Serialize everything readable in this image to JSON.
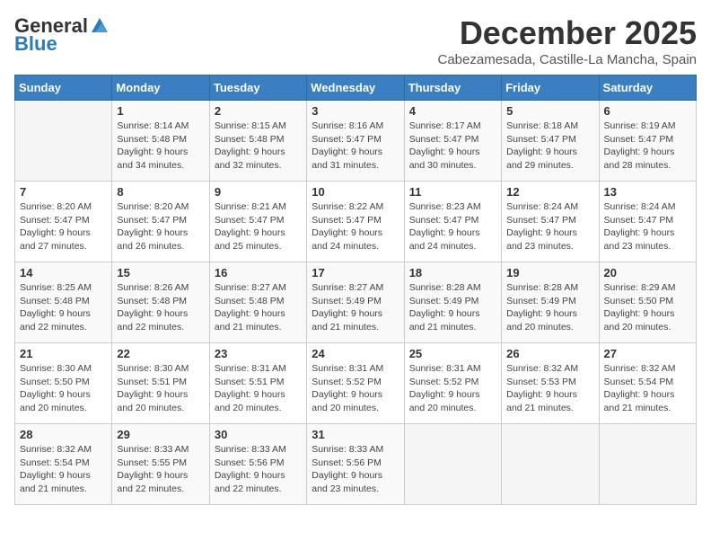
{
  "header": {
    "logo_general": "General",
    "logo_blue": "Blue",
    "month": "December 2025",
    "location": "Cabezamesada, Castille-La Mancha, Spain"
  },
  "days_of_week": [
    "Sunday",
    "Monday",
    "Tuesday",
    "Wednesday",
    "Thursday",
    "Friday",
    "Saturday"
  ],
  "weeks": [
    [
      {
        "day": "",
        "info": ""
      },
      {
        "day": "1",
        "info": "Sunrise: 8:14 AM\nSunset: 5:48 PM\nDaylight: 9 hours\nand 34 minutes."
      },
      {
        "day": "2",
        "info": "Sunrise: 8:15 AM\nSunset: 5:48 PM\nDaylight: 9 hours\nand 32 minutes."
      },
      {
        "day": "3",
        "info": "Sunrise: 8:16 AM\nSunset: 5:47 PM\nDaylight: 9 hours\nand 31 minutes."
      },
      {
        "day": "4",
        "info": "Sunrise: 8:17 AM\nSunset: 5:47 PM\nDaylight: 9 hours\nand 30 minutes."
      },
      {
        "day": "5",
        "info": "Sunrise: 8:18 AM\nSunset: 5:47 PM\nDaylight: 9 hours\nand 29 minutes."
      },
      {
        "day": "6",
        "info": "Sunrise: 8:19 AM\nSunset: 5:47 PM\nDaylight: 9 hours\nand 28 minutes."
      }
    ],
    [
      {
        "day": "7",
        "info": "Sunrise: 8:20 AM\nSunset: 5:47 PM\nDaylight: 9 hours\nand 27 minutes."
      },
      {
        "day": "8",
        "info": "Sunrise: 8:20 AM\nSunset: 5:47 PM\nDaylight: 9 hours\nand 26 minutes."
      },
      {
        "day": "9",
        "info": "Sunrise: 8:21 AM\nSunset: 5:47 PM\nDaylight: 9 hours\nand 25 minutes."
      },
      {
        "day": "10",
        "info": "Sunrise: 8:22 AM\nSunset: 5:47 PM\nDaylight: 9 hours\nand 24 minutes."
      },
      {
        "day": "11",
        "info": "Sunrise: 8:23 AM\nSunset: 5:47 PM\nDaylight: 9 hours\nand 24 minutes."
      },
      {
        "day": "12",
        "info": "Sunrise: 8:24 AM\nSunset: 5:47 PM\nDaylight: 9 hours\nand 23 minutes."
      },
      {
        "day": "13",
        "info": "Sunrise: 8:24 AM\nSunset: 5:47 PM\nDaylight: 9 hours\nand 23 minutes."
      }
    ],
    [
      {
        "day": "14",
        "info": "Sunrise: 8:25 AM\nSunset: 5:48 PM\nDaylight: 9 hours\nand 22 minutes."
      },
      {
        "day": "15",
        "info": "Sunrise: 8:26 AM\nSunset: 5:48 PM\nDaylight: 9 hours\nand 22 minutes."
      },
      {
        "day": "16",
        "info": "Sunrise: 8:27 AM\nSunset: 5:48 PM\nDaylight: 9 hours\nand 21 minutes."
      },
      {
        "day": "17",
        "info": "Sunrise: 8:27 AM\nSunset: 5:49 PM\nDaylight: 9 hours\nand 21 minutes."
      },
      {
        "day": "18",
        "info": "Sunrise: 8:28 AM\nSunset: 5:49 PM\nDaylight: 9 hours\nand 21 minutes."
      },
      {
        "day": "19",
        "info": "Sunrise: 8:28 AM\nSunset: 5:49 PM\nDaylight: 9 hours\nand 20 minutes."
      },
      {
        "day": "20",
        "info": "Sunrise: 8:29 AM\nSunset: 5:50 PM\nDaylight: 9 hours\nand 20 minutes."
      }
    ],
    [
      {
        "day": "21",
        "info": "Sunrise: 8:30 AM\nSunset: 5:50 PM\nDaylight: 9 hours\nand 20 minutes."
      },
      {
        "day": "22",
        "info": "Sunrise: 8:30 AM\nSunset: 5:51 PM\nDaylight: 9 hours\nand 20 minutes."
      },
      {
        "day": "23",
        "info": "Sunrise: 8:31 AM\nSunset: 5:51 PM\nDaylight: 9 hours\nand 20 minutes."
      },
      {
        "day": "24",
        "info": "Sunrise: 8:31 AM\nSunset: 5:52 PM\nDaylight: 9 hours\nand 20 minutes."
      },
      {
        "day": "25",
        "info": "Sunrise: 8:31 AM\nSunset: 5:52 PM\nDaylight: 9 hours\nand 20 minutes."
      },
      {
        "day": "26",
        "info": "Sunrise: 8:32 AM\nSunset: 5:53 PM\nDaylight: 9 hours\nand 21 minutes."
      },
      {
        "day": "27",
        "info": "Sunrise: 8:32 AM\nSunset: 5:54 PM\nDaylight: 9 hours\nand 21 minutes."
      }
    ],
    [
      {
        "day": "28",
        "info": "Sunrise: 8:32 AM\nSunset: 5:54 PM\nDaylight: 9 hours\nand 21 minutes."
      },
      {
        "day": "29",
        "info": "Sunrise: 8:33 AM\nSunset: 5:55 PM\nDaylight: 9 hours\nand 22 minutes."
      },
      {
        "day": "30",
        "info": "Sunrise: 8:33 AM\nSunset: 5:56 PM\nDaylight: 9 hours\nand 22 minutes."
      },
      {
        "day": "31",
        "info": "Sunrise: 8:33 AM\nSunset: 5:56 PM\nDaylight: 9 hours\nand 23 minutes."
      },
      {
        "day": "",
        "info": ""
      },
      {
        "day": "",
        "info": ""
      },
      {
        "day": "",
        "info": ""
      }
    ]
  ]
}
